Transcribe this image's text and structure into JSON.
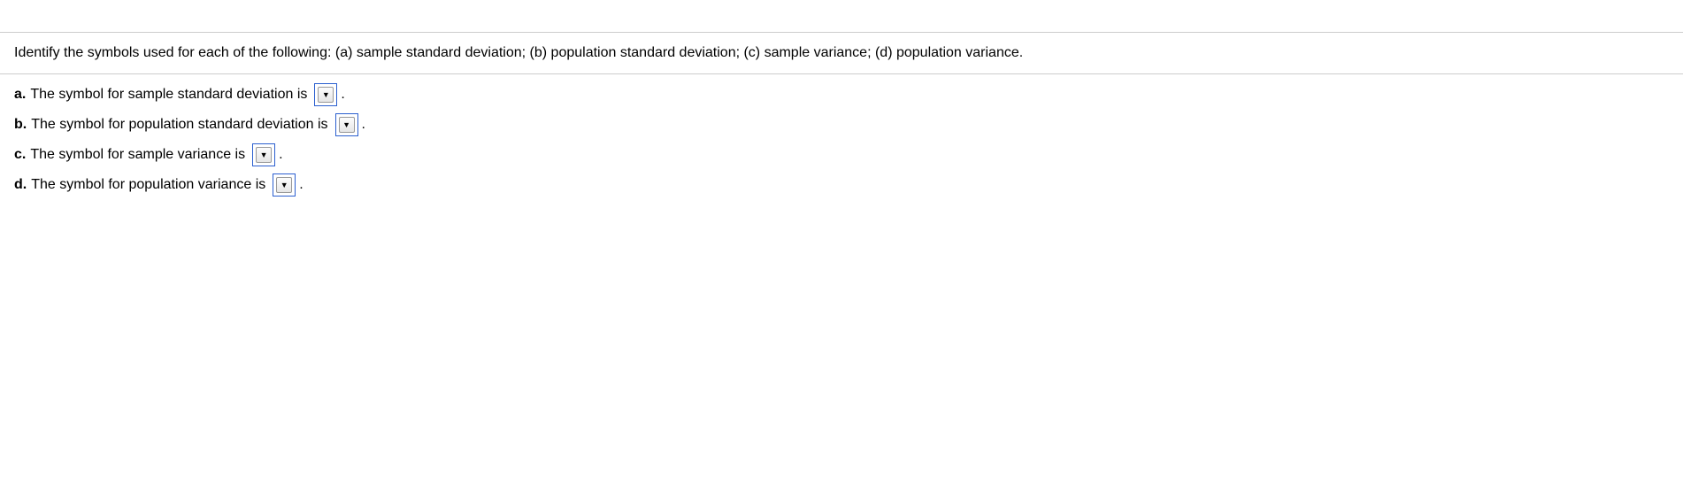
{
  "question": "Identify the symbols used for each of the following: (a) sample standard deviation; (b) population standard deviation; (c) sample variance; (d) population variance.",
  "answers": {
    "a": {
      "label": "a.",
      "text": "The symbol for sample standard deviation is",
      "period": "."
    },
    "b": {
      "label": "b.",
      "text": "The symbol for population standard deviation is",
      "period": "."
    },
    "c": {
      "label": "c.",
      "text": "The symbol for sample variance is",
      "period": "."
    },
    "d": {
      "label": "d.",
      "text": "The symbol for population variance is",
      "period": "."
    }
  }
}
